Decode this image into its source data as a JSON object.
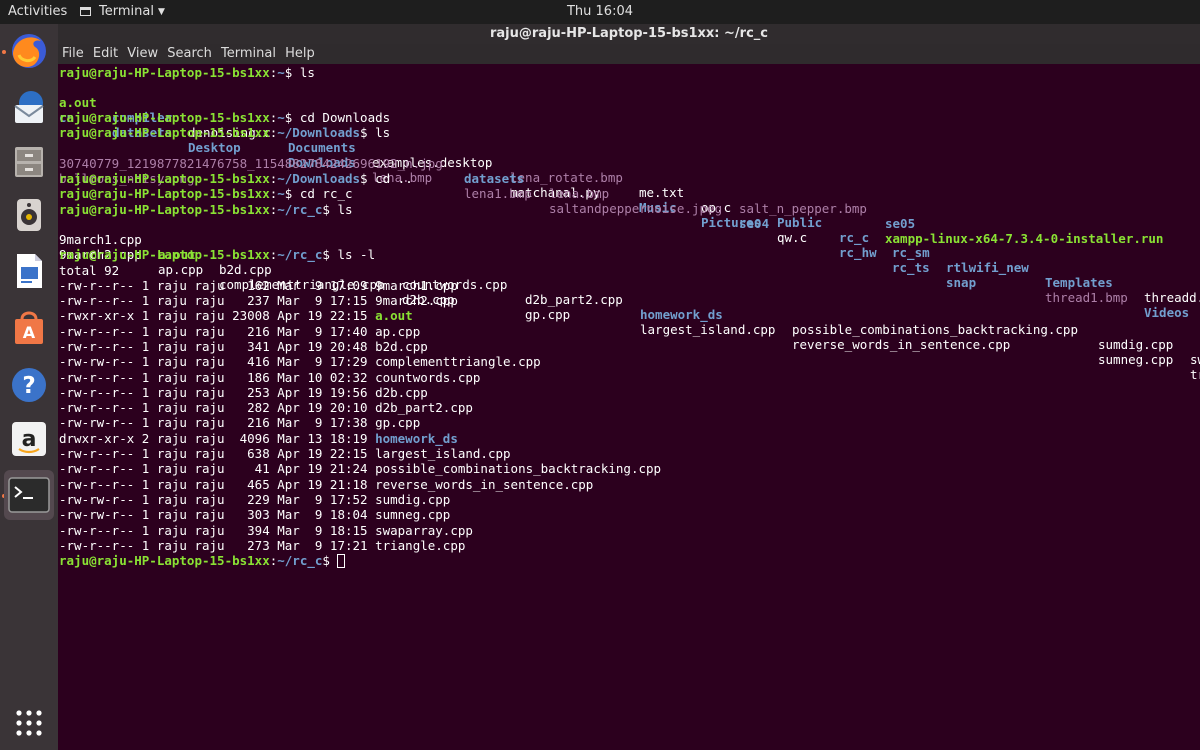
{
  "topbar": {
    "activities": "Activities",
    "app_menu": "Terminal",
    "clock": "Thu 16:04"
  },
  "window": {
    "title": "raju@raju-HP-Laptop-15-bs1xx: ~/rc_c"
  },
  "menu": [
    "File",
    "Edit",
    "View",
    "Search",
    "Terminal",
    "Help"
  ],
  "dock_items": [
    "firefox-icon",
    "thunderbird-icon",
    "files-icon",
    "rhythmbox-icon",
    "libreoffice-impress-icon",
    "software-center-icon",
    "help-icon",
    "amazon-icon",
    "terminal-icon",
    "show-apps-icon"
  ],
  "prompt": {
    "user": "raju@raju-HP-Laptop-15-bs1xx",
    "home": "~",
    "downloads": "~/Downloads",
    "rc_c": "~/rc_c"
  },
  "commands": {
    "c1": "ls",
    "c2": "cd Downloads",
    "c3": "ls",
    "c4": "cd ..",
    "c5": "cd rc_c",
    "c6": "ls",
    "c7": "ls -l"
  },
  "home_ls": {
    "row1": [
      "a.out",
      "compiler",
      "denoising.c",
      "Documents",
      "examples.desktop",
      "lena_rotate.bmp",
      "me.txt",
      "op.c",
      "Public",
      "rc_c",
      "rc_sm",
      "rtlwifi_new",
      "Templates",
      "threadd."
    ],
    "row2": [
      "cn",
      "datasets",
      "Desktop",
      "Downloads",
      "lena.bmp",
      "matchanal.py",
      "Music",
      "Pictures",
      "qw.c",
      "rc_hw",
      "rc_ts",
      "snap",
      "thread1.bmp",
      "Videos"
    ]
  },
  "downloads_ls": {
    "row1": [
      "30740779_1219877821476758_1154882784242696192_n.jpg",
      "datasets",
      "lena.bmp",
      "salt_n_pepper.bmp",
      "se05"
    ],
    "row2": [
      "balloons_noisy.png",
      "lena1.bmp",
      "saltandpeppernoise.jpeg",
      "se04",
      "xampp-linux-x64-7.3.4-0-installer.run"
    ]
  },
  "rcc_ls": {
    "row1": [
      "9march1.cpp",
      "a.out",
      "b2d.cpp",
      "countwords.cpp",
      "d2b_part2.cpp",
      "homework_ds",
      "possible_combinations_backtracking.cpp",
      "sumdig.cpp",
      "sw"
    ],
    "row2": [
      "9march2.cpp",
      "ap.cpp",
      "complementtriangle.cpp",
      "d2b.cpp",
      "gp.cpp",
      "largest_island.cpp",
      "reverse_words_in_sentence.cpp",
      "sumneg.cpp",
      "tr"
    ]
  },
  "total": "total 92",
  "long_listing": [
    {
      "meta": "-rw-r--r-- 1 raju raju   162 Mar  9 17:09 ",
      "name": "9march1.cpp"
    },
    {
      "meta": "-rw-r--r-- 1 raju raju   237 Mar  9 17:15 ",
      "name": "9march2.cpp"
    },
    {
      "meta": "-rwxr-xr-x 1 raju raju 23008 Apr 19 22:15 ",
      "name": "a.out"
    },
    {
      "meta": "-rw-r--r-- 1 raju raju   216 Mar  9 17:40 ",
      "name": "ap.cpp"
    },
    {
      "meta": "-rw-r--r-- 1 raju raju   341 Apr 19 20:48 ",
      "name": "b2d.cpp"
    },
    {
      "meta": "-rw-rw-r-- 1 raju raju   416 Mar  9 17:29 ",
      "name": "complementtriangle.cpp"
    },
    {
      "meta": "-rw-r--r-- 1 raju raju   186 Mar 10 02:32 ",
      "name": "countwords.cpp"
    },
    {
      "meta": "-rw-r--r-- 1 raju raju   253 Apr 19 19:56 ",
      "name": "d2b.cpp"
    },
    {
      "meta": "-rw-r--r-- 1 raju raju   282 Apr 19 20:10 ",
      "name": "d2b_part2.cpp"
    },
    {
      "meta": "-rw-rw-r-- 1 raju raju   216 Mar  9 17:38 ",
      "name": "gp.cpp"
    },
    {
      "meta": "drwxr-xr-x 2 raju raju  4096 Mar 13 18:19 ",
      "name": "homework_ds"
    },
    {
      "meta": "-rw-r--r-- 1 raju raju   638 Apr 19 22:15 ",
      "name": "largest_island.cpp"
    },
    {
      "meta": "-rw-r--r-- 1 raju raju    41 Apr 19 21:24 ",
      "name": "possible_combinations_backtracking.cpp"
    },
    {
      "meta": "-rw-r--r-- 1 raju raju   465 Apr 19 21:18 ",
      "name": "reverse_words_in_sentence.cpp"
    },
    {
      "meta": "-rw-rw-r-- 1 raju raju   229 Mar  9 17:52 ",
      "name": "sumdig.cpp"
    },
    {
      "meta": "-rw-rw-r-- 1 raju raju   303 Mar  9 18:04 ",
      "name": "sumneg.cpp"
    },
    {
      "meta": "-rw-r--r-- 1 raju raju   394 Mar  9 18:15 ",
      "name": "swaparray.cpp"
    },
    {
      "meta": "-rw-r--r-- 1 raju raju   273 Mar  9 17:21 ",
      "name": "triangle.cpp"
    }
  ],
  "colors": {
    "terminal_bg": "#2c001e",
    "prompt_user": "#8ae234",
    "prompt_path": "#729fcf",
    "directory": "#729fcf",
    "image": "#ad7fa8",
    "executable": "#8ae234"
  }
}
